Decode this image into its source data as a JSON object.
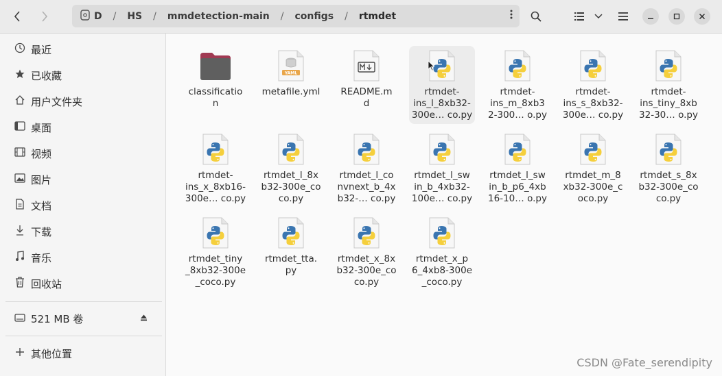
{
  "header": {
    "back_icon": "chevron-left-icon",
    "forward_icon": "chevron-right-icon",
    "path": [
      "D",
      "HS",
      "mmdetection-main",
      "configs",
      "rtmdet"
    ],
    "path_separator": "/",
    "menu_icon": "vertical-dots-icon",
    "search_icon": "search-icon",
    "view_icon": "list-view-icon",
    "view_dropdown_icon": "chevron-down-icon",
    "hamburger_icon": "menu-icon",
    "minimize_icon": "minimize-icon",
    "maximize_icon": "maximize-icon",
    "close_icon": "close-icon"
  },
  "sidebar": {
    "items": [
      {
        "label": "最近",
        "icon": "clock-icon"
      },
      {
        "label": "已收藏",
        "icon": "star-icon"
      },
      {
        "label": "用户文件夹",
        "icon": "home-icon"
      },
      {
        "label": "桌面",
        "icon": "desktop-icon"
      },
      {
        "label": "视频",
        "icon": "video-icon"
      },
      {
        "label": "图片",
        "icon": "image-icon"
      },
      {
        "label": "文档",
        "icon": "document-icon"
      },
      {
        "label": "下载",
        "icon": "download-icon"
      },
      {
        "label": "音乐",
        "icon": "music-icon"
      },
      {
        "label": "回收站",
        "icon": "trash-icon"
      }
    ],
    "volume": {
      "label": "521 MB 卷",
      "icon": "drive-icon",
      "eject_icon": "eject-icon"
    },
    "other": {
      "label": "其他位置",
      "icon": "plus-icon"
    }
  },
  "files": [
    {
      "name": "classificatio\nn",
      "type": "folder"
    },
    {
      "name": "metafile.yml",
      "type": "yaml"
    },
    {
      "name": "README.m\nd",
      "type": "markdown"
    },
    {
      "name": "rtmdet-\nins_l_8xb32-\n300e… co.py",
      "type": "python",
      "selected": true
    },
    {
      "name": "rtmdet-\nins_m_8xb3\n2-300… o.py",
      "type": "python"
    },
    {
      "name": "rtmdet-\nins_s_8xb32-\n300e… co.py",
      "type": "python"
    },
    {
      "name": "rtmdet-\nins_tiny_8xb\n32-30… o.py",
      "type": "python"
    },
    {
      "name": "rtmdet-\nins_x_8xb16-\n300e… co.py",
      "type": "python"
    },
    {
      "name": "rtmdet_l_8x\nb32-300e_co\nco.py",
      "type": "python"
    },
    {
      "name": "rtmdet_l_co\nnvnext_b_4x\nb32-… co.py",
      "type": "python"
    },
    {
      "name": "rtmdet_l_sw\nin_b_4xb32-\n100e… co.py",
      "type": "python"
    },
    {
      "name": "rtmdet_l_sw\nin_b_p6_4xb\n16-10… o.py",
      "type": "python"
    },
    {
      "name": "rtmdet_m_8\nxb32-300e_c\noco.py",
      "type": "python"
    },
    {
      "name": "rtmdet_s_8x\nb32-300e_co\nco.py",
      "type": "python"
    },
    {
      "name": "rtmdet_tiny\n_8xb32-300e\n_coco.py",
      "type": "python"
    },
    {
      "name": "rtmdet_tta.\npy",
      "type": "python"
    },
    {
      "name": "rtmdet_x_8x\nb32-300e_co\nco.py",
      "type": "python"
    },
    {
      "name": "rtmdet_x_p\n6_4xb8-300e\n_coco.py",
      "type": "python"
    }
  ],
  "watermark": "CSDN @Fate_serendipity",
  "colors": {
    "folder_top": "#a13a53",
    "folder_body": "#5f5f5f",
    "python_blue": "#3a75b0",
    "python_yellow": "#f5cf3c"
  }
}
